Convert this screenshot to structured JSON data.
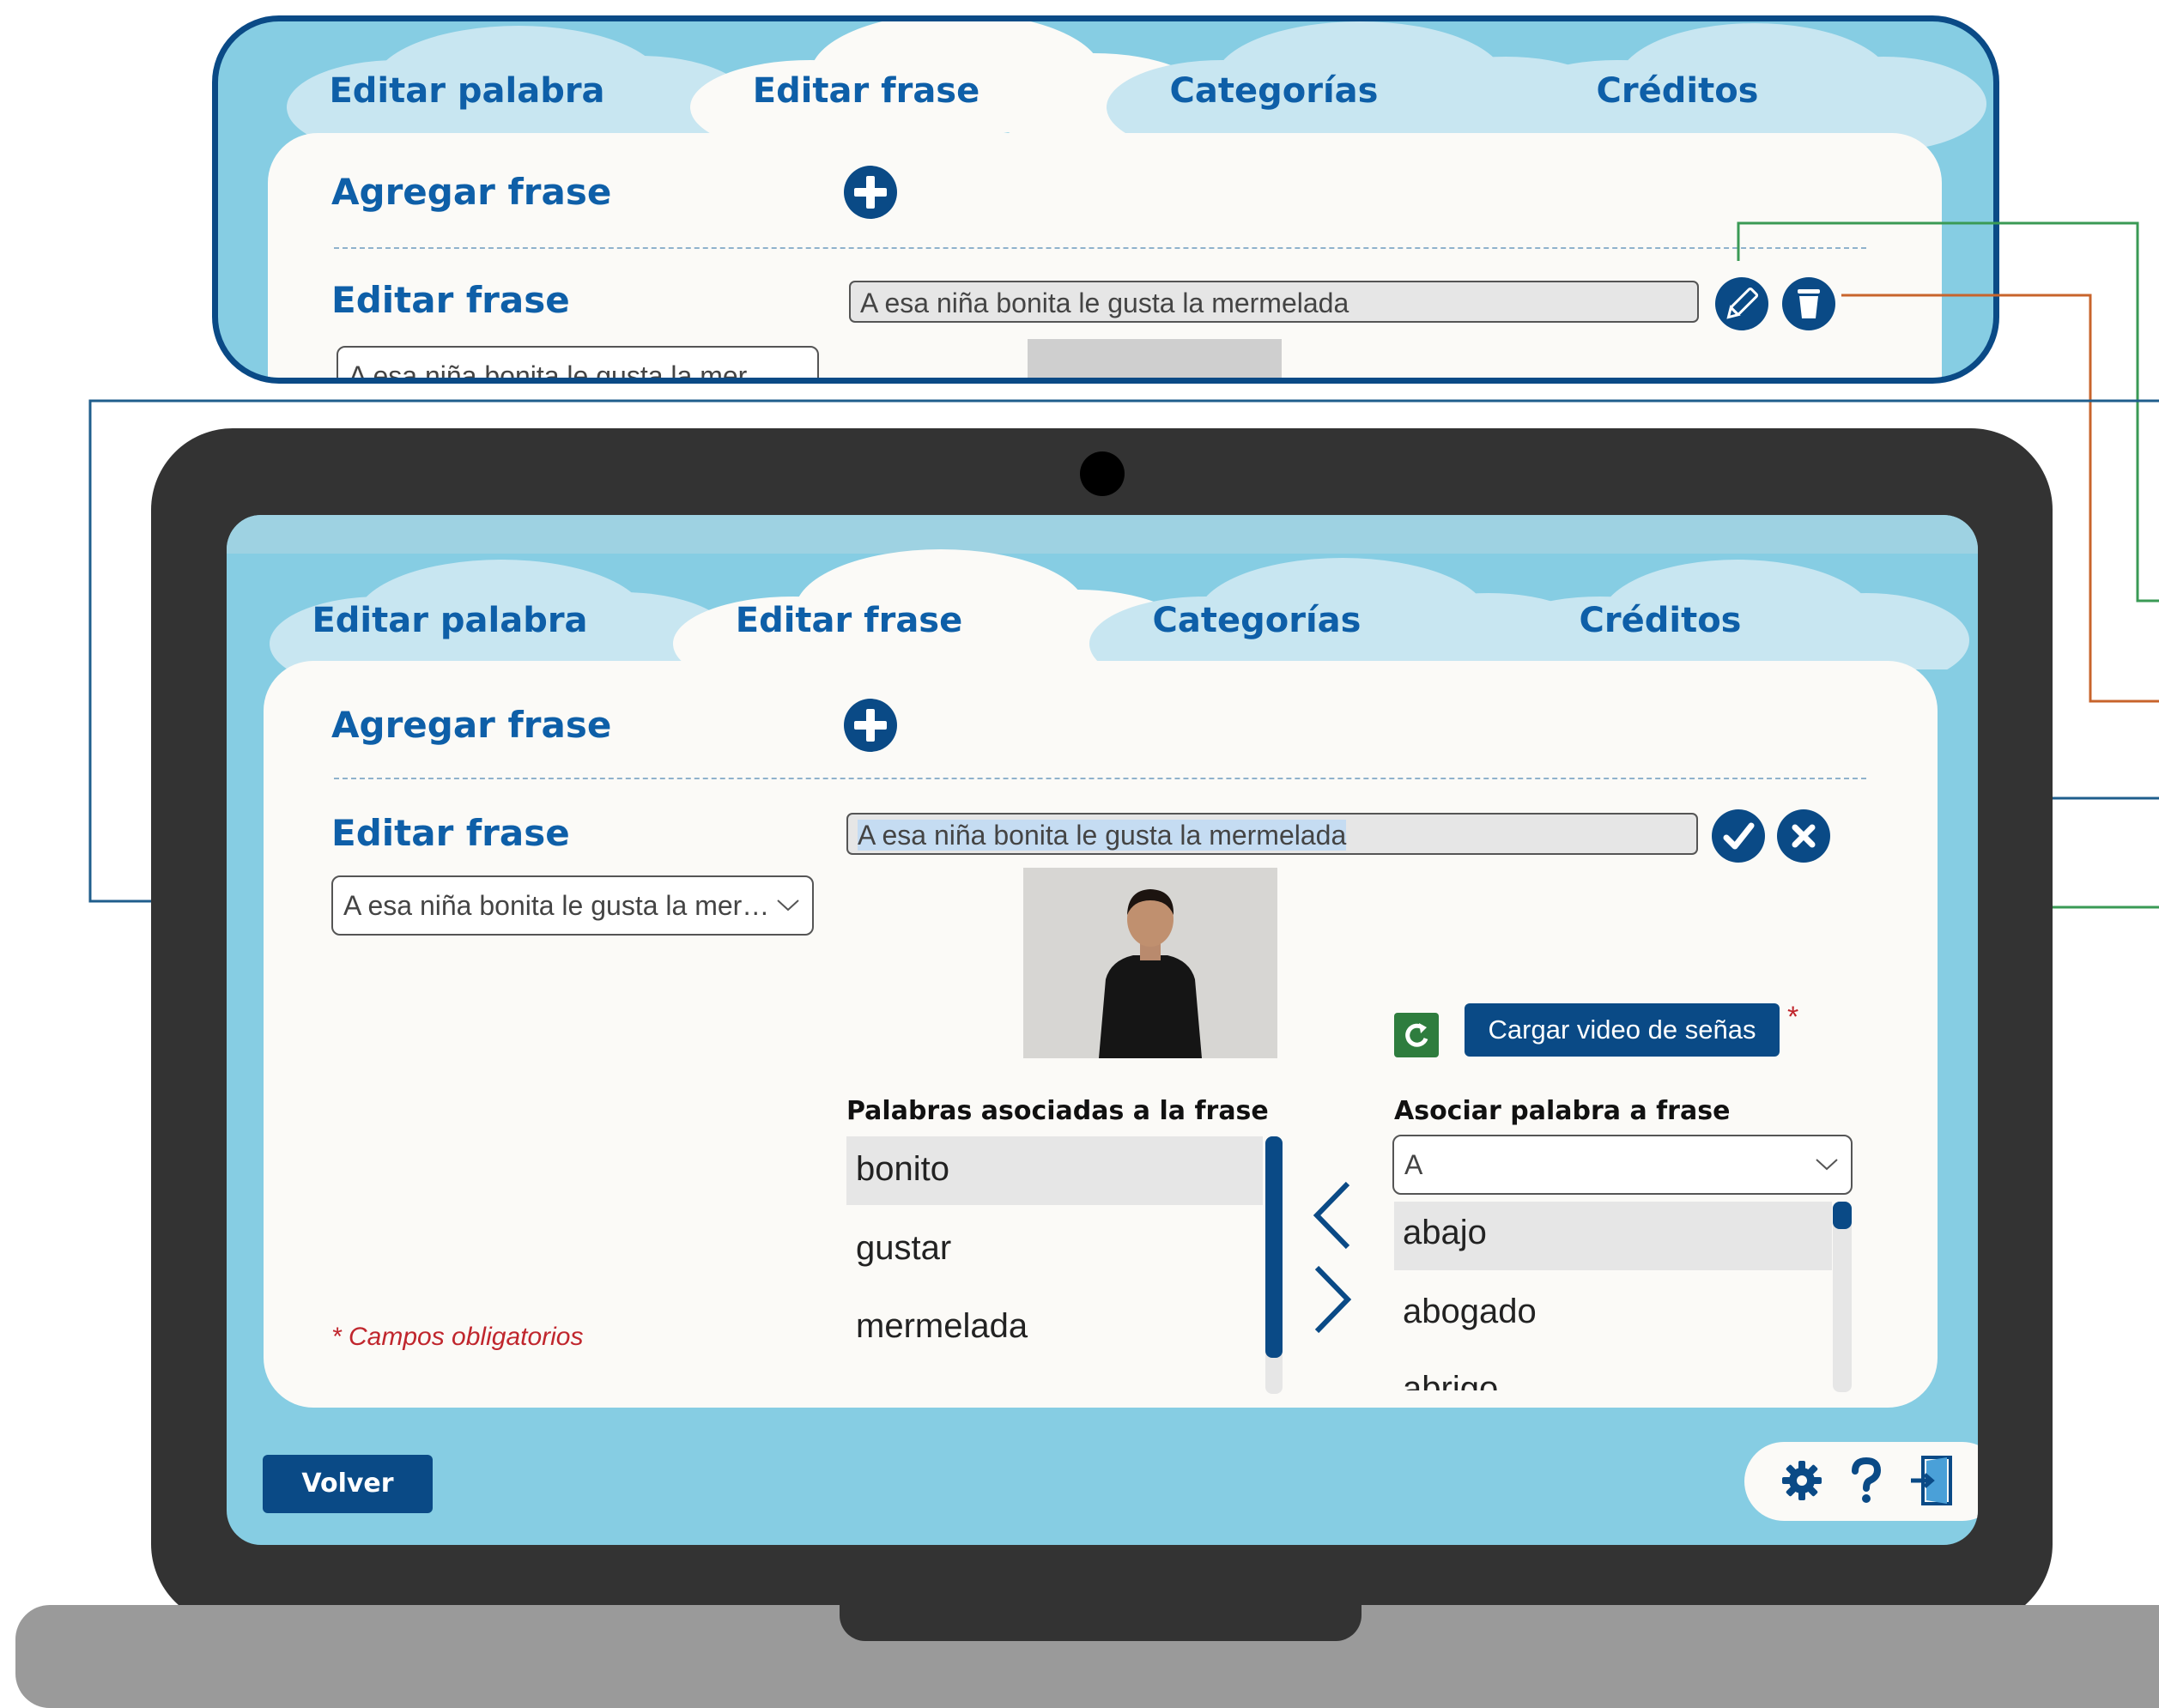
{
  "zoom": {
    "tabs": [
      {
        "label": "Editar palabra"
      },
      {
        "label": "Editar frase"
      },
      {
        "label": "Categorías"
      },
      {
        "label": "Créditos"
      }
    ],
    "add_title": "Agregar frase",
    "edit_title": "Editar frase",
    "phrase_value": "A esa niña bonita le gusta la mermelada",
    "select_value": "A esa niña bonita le gusta la mer…"
  },
  "app": {
    "tabs": [
      {
        "label": "Editar palabra",
        "active": false
      },
      {
        "label": "Editar frase",
        "active": true
      },
      {
        "label": "Categorías",
        "active": false
      },
      {
        "label": "Créditos",
        "active": false
      }
    ],
    "add_title": "Agregar frase",
    "edit_title": "Editar frase",
    "phrase_value": "A esa niña bonita le gusta la mermelada",
    "phrase_select_value": "A esa niña bonita le gusta la mer…",
    "upload_video_label": "Cargar video de señas",
    "required_mark": "*",
    "associated_title": "Palabras asociadas a la frase",
    "associated_words": [
      "bonito",
      "gustar",
      "mermelada"
    ],
    "associate_title": "Asociar palabra a frase",
    "associate_filter_value": "A",
    "available_words": [
      "abajo",
      "abogado",
      "abrigo"
    ],
    "required_note": "* Campos obligatorios",
    "back_label": "Volver"
  },
  "colors": {
    "navy": "#0a4a86",
    "title_blue": "#0e5fa8",
    "sky": "#86cde3",
    "cloud": "#c8e6f1",
    "panel": "#fbfaf7",
    "refresh_green": "#2e7d3e",
    "callout_green": "#3a9a55",
    "callout_orange": "#c8642c",
    "callout_blue": "#1f5e8c",
    "required_red": "#c0262d"
  },
  "icons": [
    "add-icon",
    "pencil-icon",
    "trash-icon",
    "check-icon",
    "cancel-icon",
    "refresh-icon",
    "chevron-left-icon",
    "chevron-right-icon",
    "gear-icon",
    "help-icon",
    "exit-icon",
    "chevron-down-icon"
  ]
}
